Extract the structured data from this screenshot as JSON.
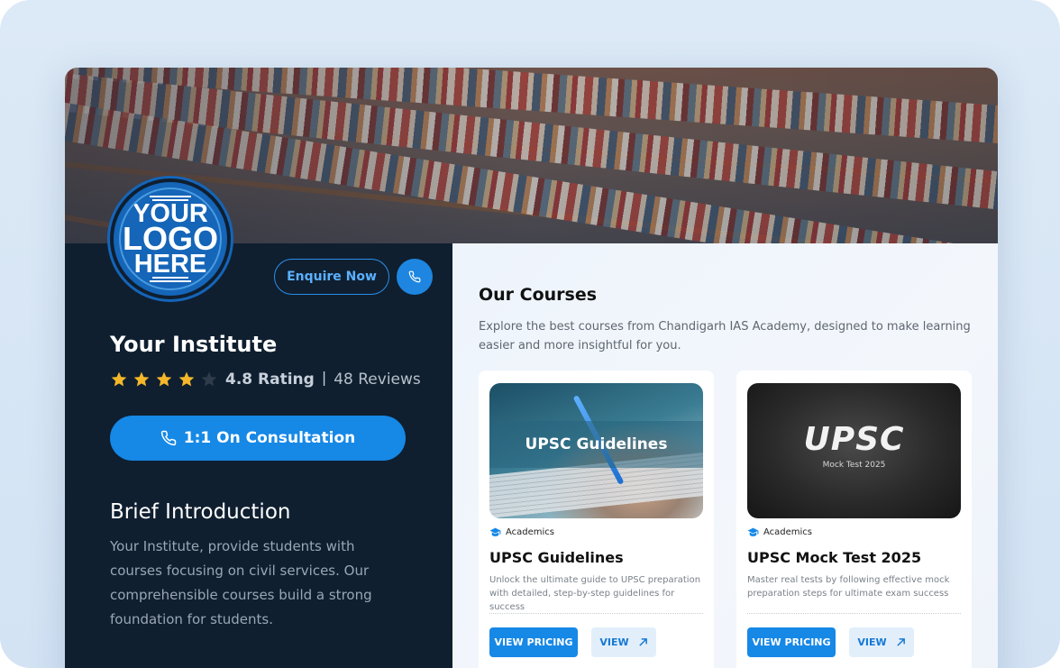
{
  "logo": {
    "line1": "YOUR",
    "line2": "LOGO",
    "line3": "HERE"
  },
  "header": {
    "enquire_label": "Enquire Now",
    "phone_icon": "phone-icon"
  },
  "institute": {
    "name": "Your Institute",
    "rating_value": 4,
    "rating_text": "4.8 Rating",
    "separator": "|",
    "reviews_text": "48 Reviews",
    "consult_label": "1:1 On Consultation",
    "brief_title": "Brief Introduction",
    "brief_text": "Your Institute, provide students with courses focusing on civil services. Our comprehensible courses build a strong foundation for students."
  },
  "courses": {
    "title": "Our Courses",
    "description": "Explore the best courses from Chandigarh IAS Academy, designed to make learning easier and more insightful for you.",
    "items": [
      {
        "image_label": "UPSC Guidelines",
        "category": "Academics",
        "title": "UPSC Guidelines",
        "description": "Unlock the ultimate guide to UPSC preparation with detailed, step-by-step guidelines for success",
        "pricing_label": "VIEW PRICING",
        "view_label": "VIEW"
      },
      {
        "image_big": "UPSC",
        "image_small": "Mock Test 2025",
        "category": "Academics",
        "title": "UPSC Mock Test 2025",
        "description": "Master real tests by following effective mock preparation steps for ultimate exam success",
        "pricing_label": "VIEW PRICING",
        "view_label": "VIEW"
      }
    ]
  },
  "colors": {
    "accent": "#1688e6",
    "panel_dark": "#0f1f30",
    "star": "#f5b72a",
    "star_empty": "#2e3b4a"
  }
}
